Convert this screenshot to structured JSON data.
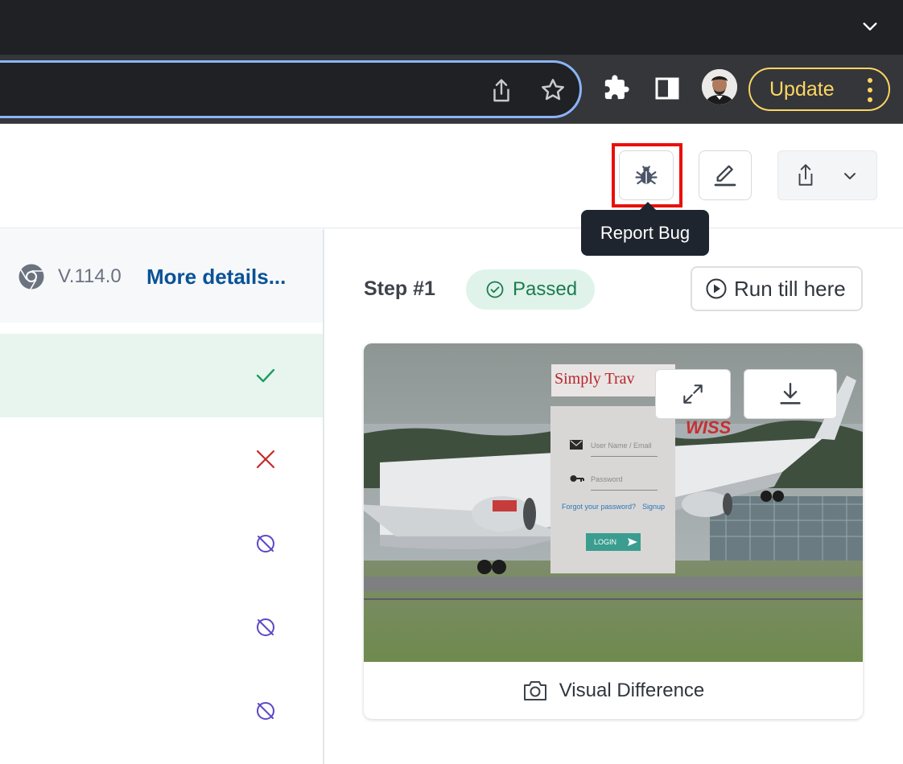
{
  "browser": {
    "update_label": "Update"
  },
  "header": {
    "tooltip": "Report Bug"
  },
  "left_panel": {
    "version": "V.114.0",
    "more_details": "More details...",
    "rows": [
      {
        "status": "passed",
        "color": "#1e9e62"
      },
      {
        "status": "failed",
        "color": "#c62828"
      },
      {
        "status": "skipped",
        "color": "#5b48c6"
      },
      {
        "status": "skipped",
        "color": "#5b48c6"
      },
      {
        "status": "skipped",
        "color": "#5b48c6"
      }
    ]
  },
  "step": {
    "label": "Step #1",
    "status": "Passed",
    "run_label": "Run till here"
  },
  "screenshot": {
    "logo_text": "Simply Trav",
    "username_placeholder": "User Name / Email",
    "password_placeholder": "Password",
    "forgot_link": "Forgot your password?",
    "signup_link": "Signup",
    "login_button": "LOGIN",
    "plane_text": "WISS"
  },
  "card_footer": {
    "label": "Visual Difference"
  },
  "colors": {
    "accent_blue": "#0a5297",
    "passed_bg": "#dff3ea",
    "highlight_red": "#e8100b",
    "update_yellow": "#fdd663"
  }
}
